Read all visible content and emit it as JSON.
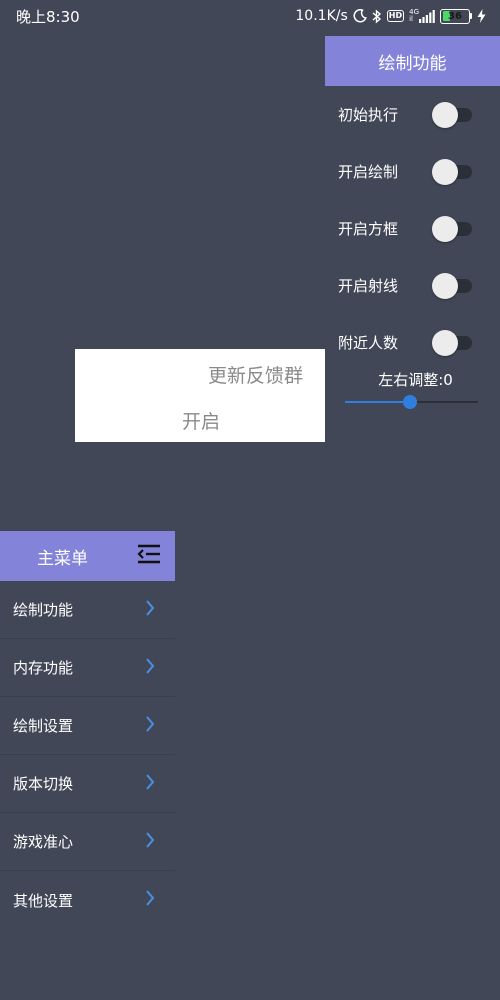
{
  "status_bar": {
    "time": "晚上8:30",
    "net_speed": "10.1K/s",
    "hd": "HD",
    "net_type_top": "4G",
    "net_type_bottom": "il",
    "battery_level": "36",
    "battery_percent": 36,
    "colors": {
      "battery": "#4cd964"
    }
  },
  "draw_panel": {
    "title": "绘制功能",
    "toggles": [
      {
        "label": "初始执行",
        "on": false
      },
      {
        "label": "开启绘制",
        "on": false
      },
      {
        "label": "开启方框",
        "on": false
      },
      {
        "label": "开启射线",
        "on": false
      },
      {
        "label": "附近人数",
        "on": false
      }
    ],
    "slider": {
      "label": "左右调整:0",
      "value_fraction": 0.49
    }
  },
  "popup": {
    "line1": "更新反馈群",
    "line2": "开启"
  },
  "main_menu": {
    "title": "主菜单",
    "items": [
      {
        "label": "绘制功能"
      },
      {
        "label": "内存功能"
      },
      {
        "label": "绘制设置"
      },
      {
        "label": "版本切换"
      },
      {
        "label": "游戏准心"
      },
      {
        "label": "其他设置"
      }
    ]
  },
  "colors": {
    "background": "#414756",
    "header": "#8383d9",
    "accent": "#2f7fe0",
    "chevron": "#4a90e2"
  },
  "icons": [
    "moon-icon",
    "bluetooth-icon",
    "hd-icon",
    "signal-icon",
    "battery-icon",
    "charging-icon",
    "menu-collapse-icon",
    "chevron-right-icon"
  ]
}
